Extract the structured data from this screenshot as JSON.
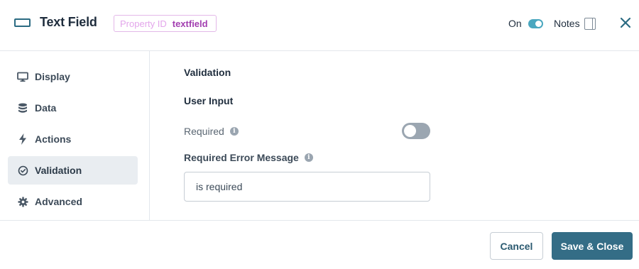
{
  "header": {
    "title": "Text Field",
    "title_icon": "text-field-icon",
    "property_id_label": "Property ID",
    "property_id_value": "textfield",
    "on_label": "On",
    "on_toggle_state": true,
    "notes_label": "Notes",
    "notes_icon": "notes-panel-icon",
    "close_icon": "close-icon"
  },
  "sidebar": {
    "items": [
      {
        "label": "Display",
        "icon": "monitor-icon",
        "active": false
      },
      {
        "label": "Data",
        "icon": "database-icon",
        "active": false
      },
      {
        "label": "Actions",
        "icon": "lightning-icon",
        "active": false
      },
      {
        "label": "Validation",
        "icon": "check-circle-icon",
        "active": true
      },
      {
        "label": "Advanced",
        "icon": "gear-icon",
        "active": false
      }
    ]
  },
  "main": {
    "section_title": "Validation",
    "subsection_title": "User Input",
    "required_label": "Required",
    "required_toggle_state": false,
    "error_message_label": "Required Error Message",
    "error_message_value": "is required"
  },
  "footer": {
    "cancel_label": "Cancel",
    "save_label": "Save & Close"
  },
  "colors": {
    "accent": "#346d86",
    "toggle_on": "#4aa7bf",
    "toggle_off": "#9ba6b1",
    "badge_border": "#e3b8e8",
    "badge_value": "#a23eb0"
  }
}
